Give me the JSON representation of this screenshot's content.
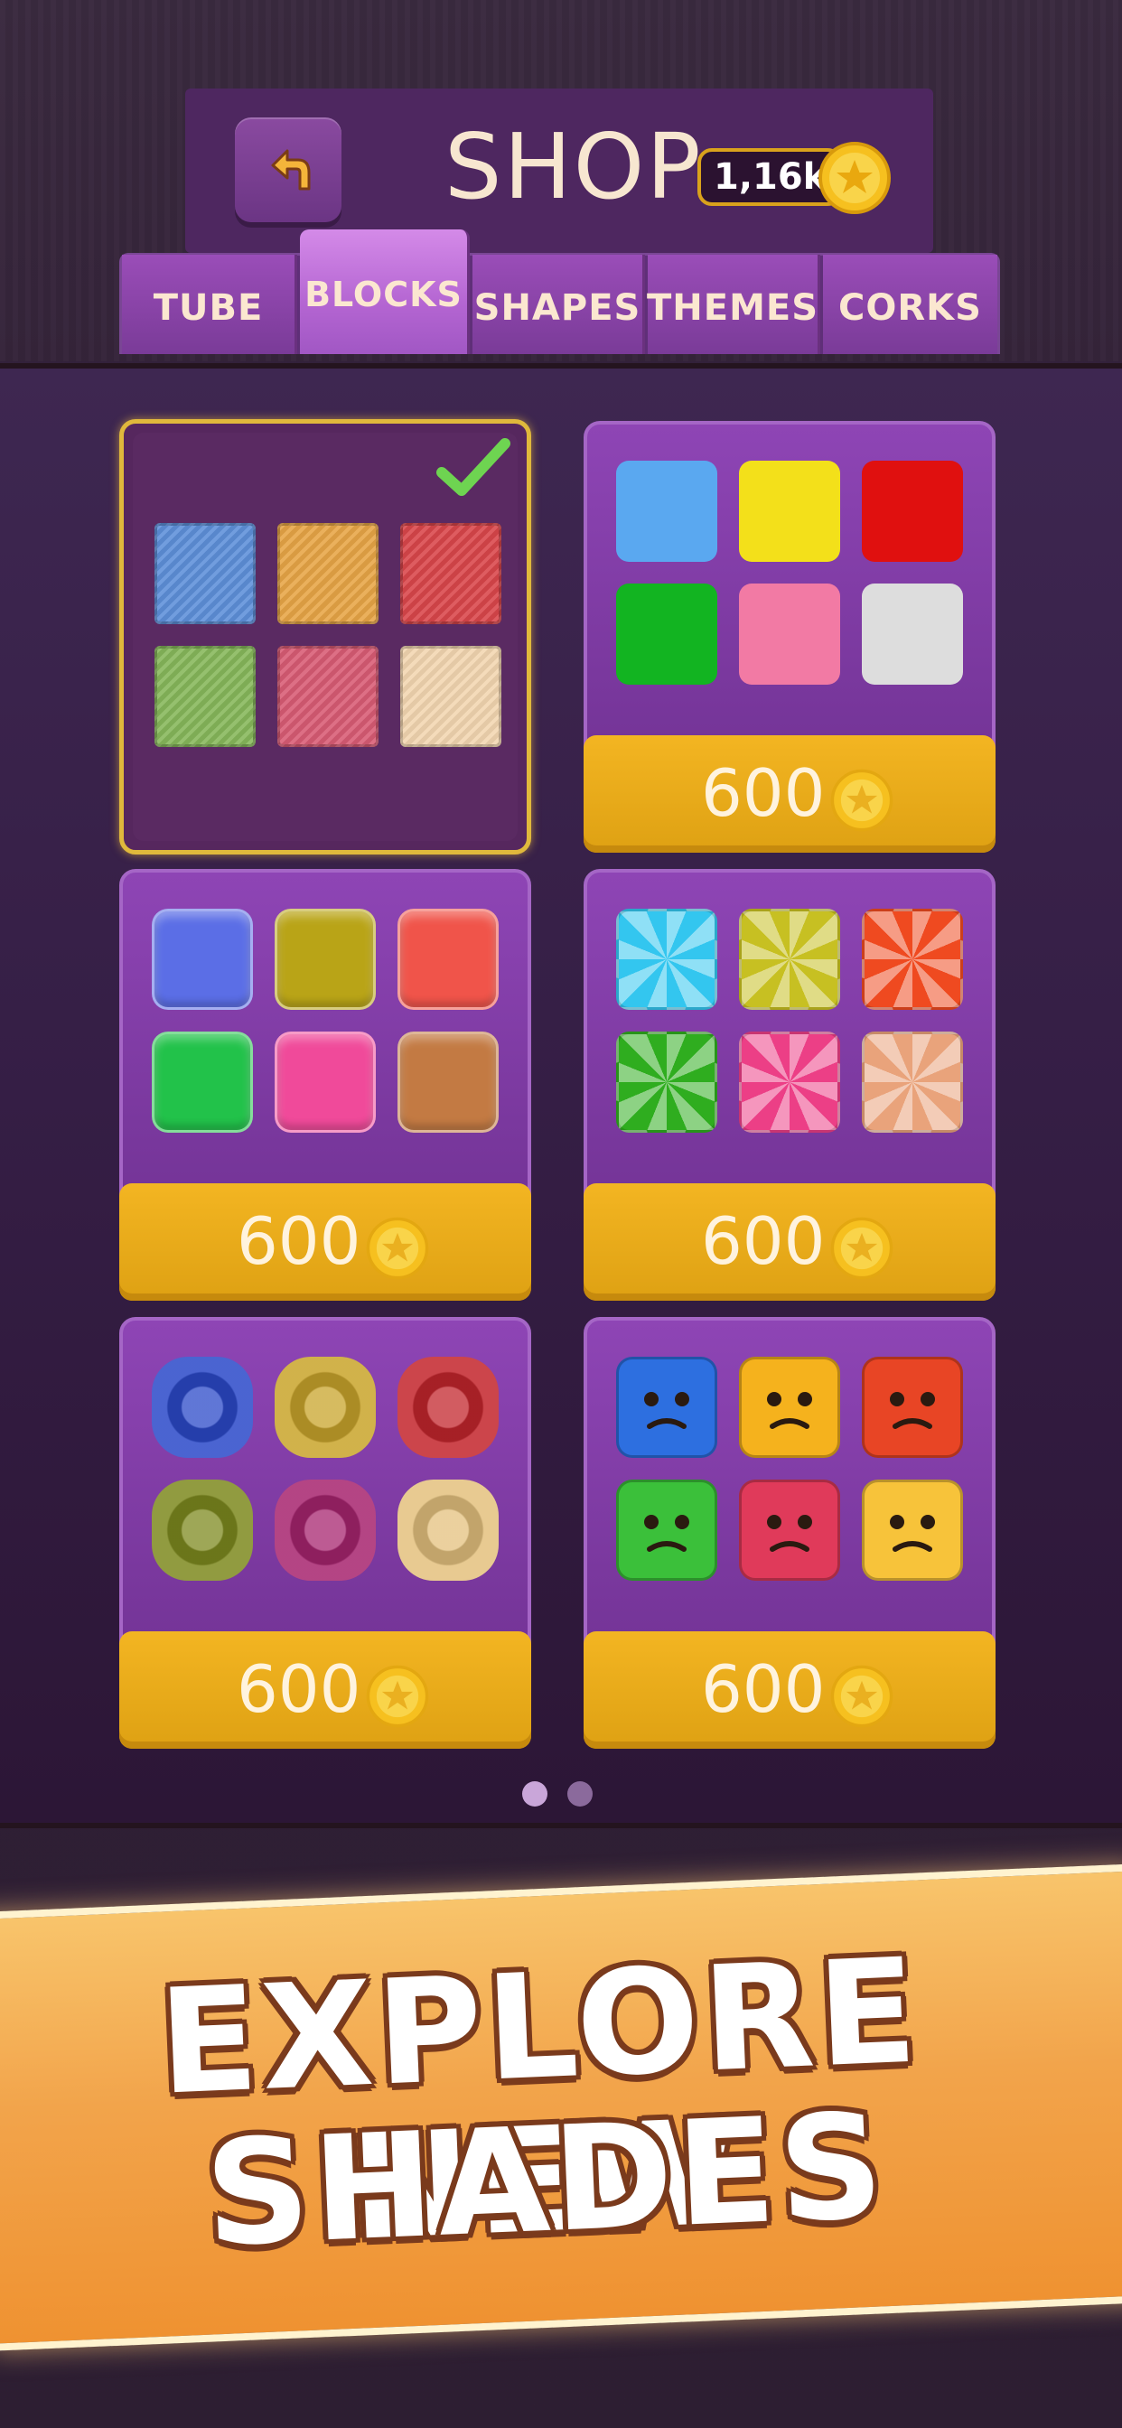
{
  "header": {
    "title": "SHOP",
    "coins": "1,16k",
    "back_icon": "back-arrow-icon",
    "coin_icon": "star-coin-icon"
  },
  "tabs": [
    {
      "label": "TUBE",
      "active": false
    },
    {
      "label": "BLOCKS",
      "active": true
    },
    {
      "label": "SHAPES",
      "active": false
    },
    {
      "label": "THEMES",
      "active": false
    },
    {
      "label": "CORKS",
      "active": false
    }
  ],
  "cards": [
    {
      "style": "wood",
      "selected": true,
      "price": null,
      "colors": [
        "#5d8fd9",
        "#e7a546",
        "#d9464a",
        "#86b75a",
        "#d85b74",
        "#f2d6b0"
      ]
    },
    {
      "style": "flat",
      "selected": false,
      "price": "600",
      "colors": [
        "#5aa8f0",
        "#f3e01a",
        "#e0100f",
        "#12b421",
        "#f27aa4",
        "#dddddd"
      ]
    },
    {
      "style": "glossy",
      "selected": false,
      "price": "600",
      "colors": [
        "#5b6ee6",
        "#b9a417",
        "#f0544a",
        "#22c24a",
        "#f04a9a",
        "#c37a43"
      ]
    },
    {
      "style": "candy",
      "selected": false,
      "price": "600",
      "colors": [
        "#33c6ef",
        "#c7c022",
        "#ef4a20",
        "#2fad1f",
        "#ec3f86",
        "#e9a37b"
      ]
    },
    {
      "style": "gem",
      "selected": false,
      "price": "600",
      "colors": [
        "#2b49c9",
        "#c9a42b",
        "#c3252c",
        "#7e8a1f",
        "#a7246f",
        "#e4c17e"
      ]
    },
    {
      "style": "emoji",
      "selected": false,
      "price": "600",
      "colors": [
        "#2d6fe0",
        "#f5b21d",
        "#e84525",
        "#3bc03a",
        "#e03a5a",
        "#f7c33a"
      ]
    }
  ],
  "pagination": {
    "pages": 2,
    "current": 1
  },
  "banner": {
    "line1": "EXPLORE NEW",
    "line2": "SHADES"
  },
  "colors": {
    "accent": "#f3b522",
    "panel": "#6c2f8e",
    "selected_border": "#e0b83c"
  }
}
